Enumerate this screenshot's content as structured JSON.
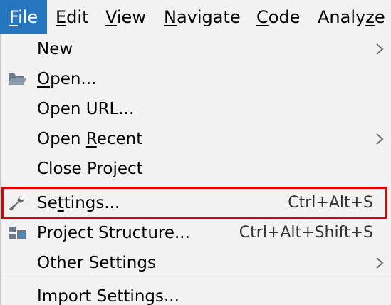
{
  "menubar": {
    "items": [
      {
        "label": "File",
        "mnemonic": "F",
        "rest": "ile",
        "active": true
      },
      {
        "label": "Edit",
        "mnemonic": "E",
        "rest": "dit"
      },
      {
        "label": "View",
        "mnemonic": "V",
        "rest": "iew"
      },
      {
        "label": "Navigate",
        "mnemonic": "N",
        "rest": "avigate"
      },
      {
        "label": "Code",
        "mnemonic": "C",
        "rest": "ode"
      },
      {
        "label": "Analyze",
        "pre": "Analy",
        "mnemonic": "z",
        "rest": "e"
      }
    ]
  },
  "file_menu": {
    "items": [
      {
        "label": "New",
        "submenu": true
      },
      {
        "pre": "",
        "mnemonic": "O",
        "rest": "pen...",
        "icon": "folder-open-icon"
      },
      {
        "label": "Open URL..."
      },
      {
        "pre": "Open ",
        "mnemonic": "R",
        "rest": "ecent",
        "submenu": true
      },
      {
        "label": "Close Project"
      },
      {
        "pre": "Se",
        "mnemonic": "t",
        "rest": "tings...",
        "shortcut": "Ctrl+Alt+S",
        "icon": "wrench-icon",
        "highlighted": true
      },
      {
        "label": "Project Structure...",
        "shortcut": "Ctrl+Alt+Shift+S",
        "icon": "project-structure-icon"
      },
      {
        "label": "Other Settings",
        "submenu": true
      },
      {
        "label": "Import Settings..."
      }
    ]
  },
  "colors": {
    "menu_background": "#f2f2f2",
    "active_menu": "#2675bf",
    "highlight_border": "#e00000"
  }
}
